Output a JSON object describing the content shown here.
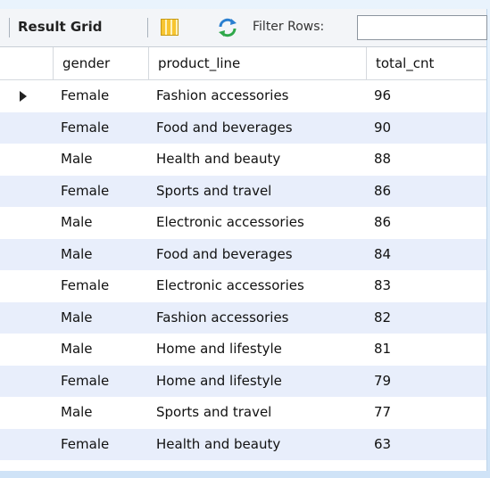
{
  "toolbar": {
    "result_grid_label": "Result Grid",
    "grid_icon": "grid-layout-icon",
    "refresh_icon": "refresh-icon",
    "filter_label": "Filter Rows:",
    "filter_value": ""
  },
  "table": {
    "columns": [
      "gender",
      "product_line",
      "total_cnt"
    ],
    "rows": [
      [
        "Female",
        "Fashion accessories",
        "96"
      ],
      [
        "Female",
        "Food and beverages",
        "90"
      ],
      [
        "Male",
        "Health and beauty",
        "88"
      ],
      [
        "Female",
        "Sports and travel",
        "86"
      ],
      [
        "Male",
        "Electronic accessories",
        "86"
      ],
      [
        "Male",
        "Food and beverages",
        "84"
      ],
      [
        "Female",
        "Electronic accessories",
        "83"
      ],
      [
        "Male",
        "Fashion accessories",
        "82"
      ],
      [
        "Male",
        "Home and lifestyle",
        "81"
      ],
      [
        "Female",
        "Home and lifestyle",
        "79"
      ],
      [
        "Male",
        "Sports and travel",
        "77"
      ],
      [
        "Female",
        "Health and beauty",
        "63"
      ]
    ],
    "selected_row": 0
  },
  "colors": {
    "alt_row": "#e8eefb",
    "toolbar_bg": "#f3f5f8",
    "frame_bg": "#dcebfa"
  }
}
